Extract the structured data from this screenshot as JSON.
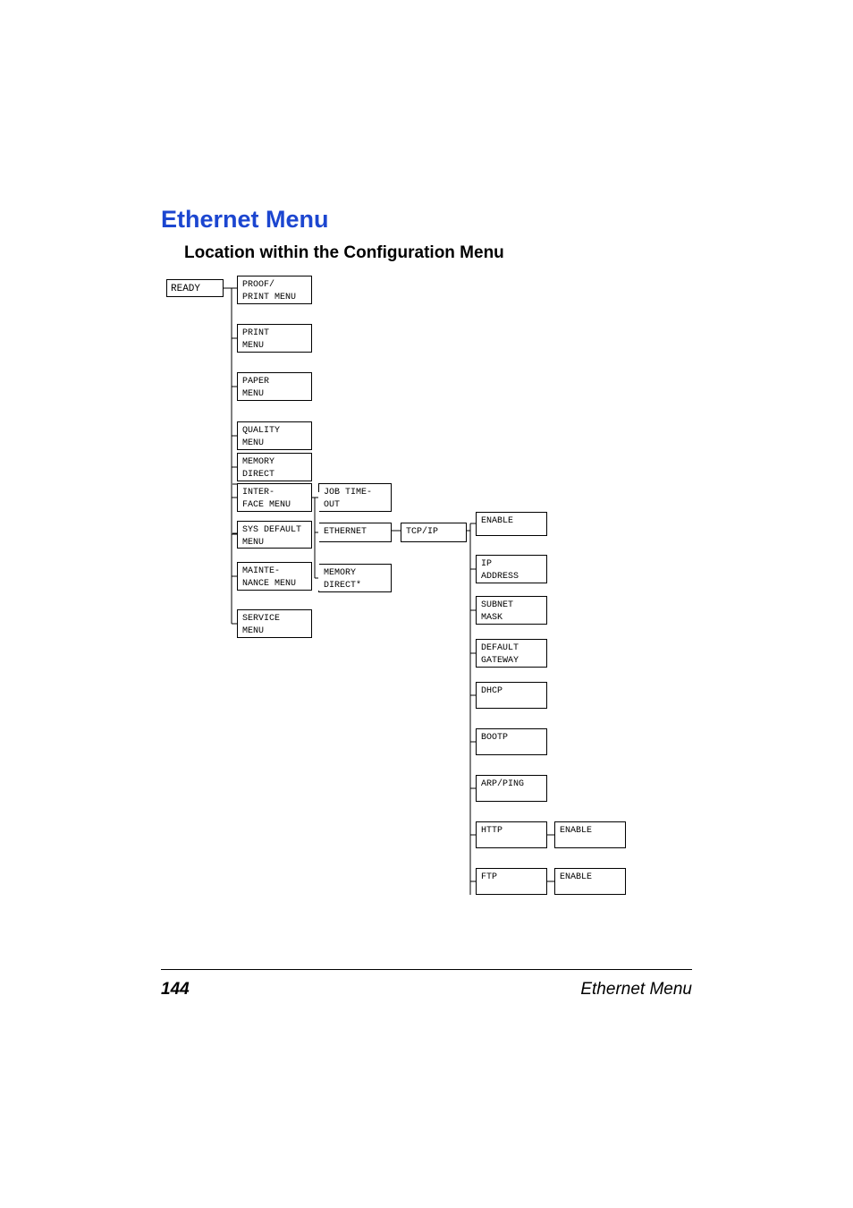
{
  "title": "Ethernet Menu",
  "subtitle": "Location within the Configuration Menu",
  "ready": "READY",
  "col1": {
    "proof_print": "PROOF/\nPRINT MENU",
    "print": "PRINT\nMENU",
    "paper": "PAPER\nMENU",
    "quality": "QUALITY\nMENU",
    "memory_direct": "MEMORY\nDIRECT",
    "interface": "INTER-\nFACE MENU",
    "sys_default": "SYS DEFAULT\nMENU",
    "maintenance": "MAINTE-\nNANCE MENU",
    "service": "SERVICE\nMENU"
  },
  "col2": {
    "job_timeout": "JOB TIME-\nOUT",
    "ethernet": "ETHERNET",
    "memory_direct": "MEMORY\nDIRECT*"
  },
  "col3": {
    "tcpip": "TCP/IP"
  },
  "col4": {
    "enable": "ENABLE",
    "ip_address": "IP\nADDRESS",
    "subnet_mask": "SUBNET\nMASK",
    "default_gateway": "DEFAULT\nGATEWAY",
    "dhcp": "DHCP",
    "bootp": "BOOTP",
    "arp_ping": "ARP/PING",
    "http": "HTTP",
    "ftp": "FTP"
  },
  "col5": {
    "http_enable": "ENABLE",
    "ftp_enable": "ENABLE"
  },
  "footer": {
    "page": "144",
    "label": "Ethernet Menu"
  }
}
